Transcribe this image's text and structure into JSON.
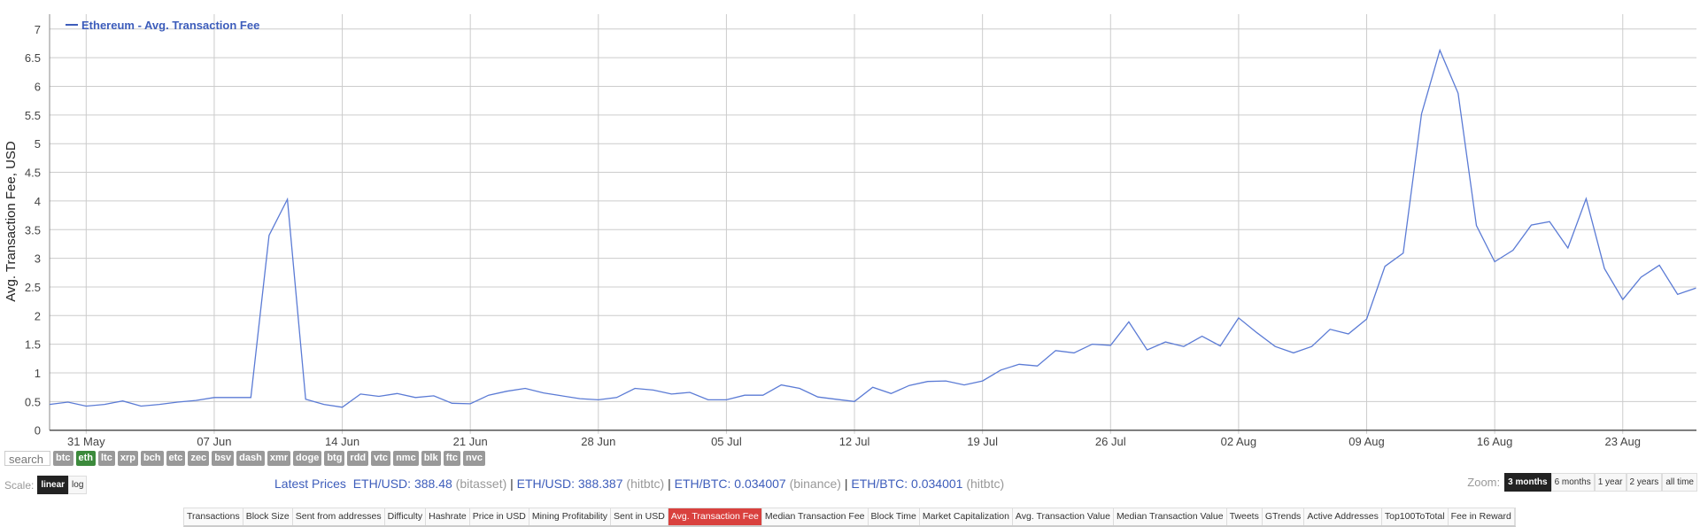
{
  "chart_data": {
    "type": "line",
    "title": "",
    "ylabel": "Avg. Transaction Fee, USD",
    "xlabel": "",
    "ylim": [
      0,
      7
    ],
    "yticks": [
      "0",
      "0.5",
      "1",
      "1.5",
      "2",
      "2.5",
      "3",
      "3.5",
      "4",
      "4.5",
      "5",
      "5.5",
      "6",
      "6.5",
      "7"
    ],
    "xticks": [
      "31 May",
      "07 Jun",
      "14 Jun",
      "21 Jun",
      "28 Jun",
      "05 Jul",
      "12 Jul",
      "19 Jul",
      "26 Jul",
      "02 Aug",
      "09 Aug",
      "16 Aug",
      "23 Aug"
    ],
    "xtick_day_offsets": [
      2,
      9,
      16,
      23,
      30,
      37,
      44,
      51,
      58,
      65,
      72,
      79,
      86
    ],
    "x_start": "29 May",
    "x_end": "27 Aug",
    "grid": true,
    "legend_position": "top-left",
    "line_color": "#5b7bd5",
    "series": [
      {
        "name": "Ethereum - Avg. Transaction Fee",
        "values": [
          0.45,
          0.49,
          0.42,
          0.45,
          0.51,
          0.42,
          0.45,
          0.49,
          0.52,
          0.57,
          0.57,
          0.57,
          3.4,
          4.03,
          0.54,
          0.45,
          0.4,
          0.63,
          0.59,
          0.64,
          0.57,
          0.6,
          0.47,
          0.46,
          0.61,
          0.68,
          0.73,
          0.65,
          0.6,
          0.55,
          0.53,
          0.57,
          0.73,
          0.7,
          0.63,
          0.66,
          0.53,
          0.53,
          0.61,
          0.61,
          0.79,
          0.73,
          0.58,
          0.54,
          0.5,
          0.75,
          0.64,
          0.78,
          0.85,
          0.86,
          0.79,
          0.86,
          1.05,
          1.15,
          1.12,
          1.39,
          1.35,
          1.5,
          1.48,
          1.89,
          1.4,
          1.54,
          1.46,
          1.64,
          1.47,
          1.96,
          1.7,
          1.46,
          1.35,
          1.46,
          1.76,
          1.68,
          1.94,
          2.86,
          3.09,
          5.52,
          6.63,
          5.88,
          3.57,
          2.94,
          3.14,
          3.58,
          3.64,
          3.18,
          4.04,
          2.82,
          2.28,
          2.67,
          2.88,
          2.37,
          2.48
        ]
      }
    ]
  },
  "controls": {
    "search_placeholder": "search",
    "coins": [
      "btc",
      "eth",
      "ltc",
      "xrp",
      "bch",
      "etc",
      "zec",
      "bsv",
      "dash",
      "xmr",
      "doge",
      "btg",
      "rdd",
      "vtc",
      "nmc",
      "blk",
      "ftc",
      "nvc"
    ],
    "active_coin": "eth",
    "scale_label": "Scale:",
    "scale_options": [
      "linear",
      "log"
    ],
    "zoom_label": "Zoom:",
    "zoom_options": [
      "3 months",
      "6 months",
      "1 year",
      "2 years",
      "all time"
    ]
  },
  "prices": {
    "label": "Latest Prices",
    "entries": [
      {
        "pair": "ETH/USD: 388.48",
        "source": "(bitasset)"
      },
      {
        "pair": "ETH/USD: 388.387",
        "source": "(hitbtc)"
      },
      {
        "pair": "ETH/BTC: 0.034007",
        "source": "(binance)"
      },
      {
        "pair": "ETH/BTC: 0.034001",
        "source": "(hitbtc)"
      }
    ],
    "separator": "|"
  },
  "nav": {
    "items": [
      "Transactions",
      "Block Size",
      "Sent from addresses",
      "Difficulty",
      "Hashrate",
      "Price in USD",
      "Mining Profitability",
      "Sent in USD",
      "Avg. Transaction Fee",
      "Median Transaction Fee",
      "Block Time",
      "Market Capitalization",
      "Avg. Transaction Value",
      "Median Transaction Value",
      "Tweets",
      "GTrends",
      "Active Addresses",
      "Top100ToTotal",
      "Fee in Reward"
    ],
    "active": "Avg. Transaction Fee"
  }
}
